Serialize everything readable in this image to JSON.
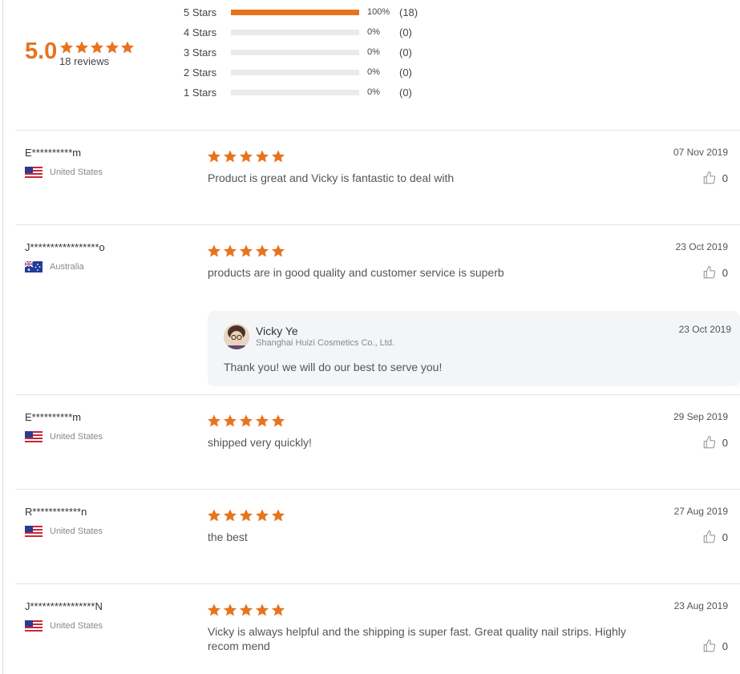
{
  "summary": {
    "score": "5.0",
    "stars": 5,
    "reviews_label": "18 reviews",
    "accent_color": "#e8731f",
    "distribution": [
      {
        "label": "5 Stars",
        "percent_text": "100%",
        "count_text": "(18)",
        "fraction": 1.0
      },
      {
        "label": "4 Stars",
        "percent_text": "0%",
        "count_text": "(0)",
        "fraction": 0
      },
      {
        "label": "3 Stars",
        "percent_text": "0%",
        "count_text": "(0)",
        "fraction": 0
      },
      {
        "label": "2 Stars",
        "percent_text": "0%",
        "count_text": "(0)",
        "fraction": 0
      },
      {
        "label": "1 Stars",
        "percent_text": "0%",
        "count_text": "(0)",
        "fraction": 0
      }
    ]
  },
  "reviews": [
    {
      "name": "E**********m",
      "country": "United States",
      "flag_icon": "us-flag-icon",
      "rating": 5,
      "text": "Product is great and Vicky is fantastic to deal with",
      "date": "07 Nov 2019",
      "likes": "0"
    },
    {
      "name": "J*****************o",
      "country": "Australia",
      "flag_icon": "au-flag-icon",
      "rating": 5,
      "text": "products are in good quality and customer service is superb",
      "date": "23 Oct 2019",
      "likes": "0",
      "reply": {
        "name": "Vicky Ye",
        "company": "Shanghai Huizi Cosmetics Co., Ltd.",
        "date": "23 Oct 2019",
        "text": "Thank you! we will do our best to serve you!"
      }
    },
    {
      "name": "E**********m",
      "country": "United States",
      "flag_icon": "us-flag-icon",
      "rating": 5,
      "text": "shipped very quickly!",
      "date": "29 Sep 2019",
      "likes": "0"
    },
    {
      "name": "R************n",
      "country": "United States",
      "flag_icon": "us-flag-icon",
      "rating": 5,
      "text": "the best",
      "date": "27 Aug 2019",
      "likes": "0"
    },
    {
      "name": "J****************N",
      "country": "United States",
      "flag_icon": "us-flag-icon",
      "rating": 5,
      "text": "Vicky is always helpful and the shipping is super fast. Great quality nail strips. Highly recom mend",
      "date": "23 Aug 2019",
      "likes": "0"
    }
  ]
}
